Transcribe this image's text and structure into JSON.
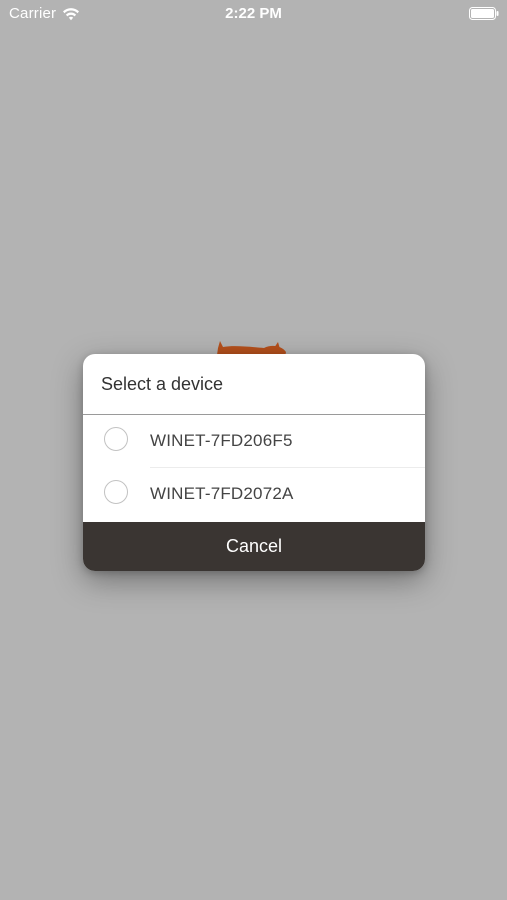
{
  "status_bar": {
    "carrier": "Carrier",
    "time": "2:22 PM"
  },
  "dialog": {
    "title": "Select a device",
    "devices": [
      {
        "label": "WINET-7FD206F5",
        "selected": false
      },
      {
        "label": "WINET-7FD2072A",
        "selected": false
      }
    ],
    "cancel_label": "Cancel"
  },
  "colors": {
    "backdrop": "#b3b3b3",
    "cancel_bg": "#3a3532",
    "logo_accent": "#b5501c"
  },
  "icons": {
    "wifi": "wifi-icon",
    "battery": "battery-icon",
    "logo": "app-logo-icon"
  }
}
